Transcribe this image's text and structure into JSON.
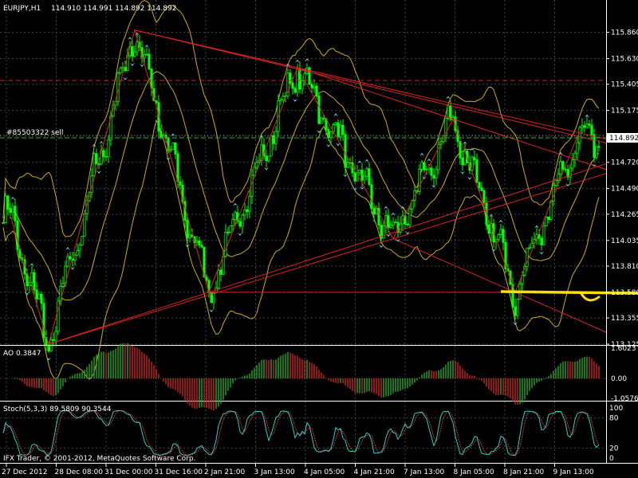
{
  "symbol_label": "EURJPY,H1",
  "ohlc_label": "114.910 114.991 114.892 114.892",
  "order_label": "#85503322 sell",
  "current_price_label": "114.892",
  "ao_label": "AO 0.3847",
  "stoch_label": "Stoch(5,3,3) 89.5809 90.3544",
  "copyright_label": "IFX Trader, © 2001-2012, MetaQuotes Software Corp.",
  "colors": {
    "background": "#000000",
    "grid": "#3a4a4a",
    "candle": "#00ff00",
    "bollinger": "#ccaa22",
    "zigzag": "#dd2222",
    "fractal": "#66ccdd",
    "order_line": "#33aa33",
    "level_line": "#cc2222",
    "highlight": "#ffdd00",
    "stoch_main": "#33cccc",
    "stoch_signal": "#cc3333",
    "ao_up": "#22aa22",
    "ao_down": "#cc2222"
  },
  "chart_data": [
    {
      "type": "candlestick",
      "symbol": "EURJPY",
      "timeframe": "H1",
      "y_ticks": [
        "115.860",
        "115.630",
        "115.405",
        "115.175",
        "114.950",
        "114.720",
        "114.490",
        "114.265",
        "114.035",
        "113.810",
        "113.580",
        "113.355",
        "113.125"
      ],
      "ylim": [
        113.125,
        115.99
      ],
      "x_ticks": [
        "27 Dec 2012",
        "28 Dec 08:00",
        "31 Dec 00:00",
        "31 Dec 16:00",
        "2 Jan 21:00",
        "3 Jan 13:00",
        "4 Jan 05:00",
        "4 Jan 21:00",
        "7 Jan 13:00",
        "8 Jan 05:00",
        "8 Jan 21:00",
        "9 Jan 13:00"
      ],
      "zigzag_points": [
        {
          "bar": 3,
          "price": 114.25
        },
        {
          "bar": 19,
          "price": 113.125
        },
        {
          "bar": 55,
          "price": 115.88
        },
        {
          "bar": 86,
          "price": 113.58
        },
        {
          "bar": 123,
          "price": 115.55
        },
        {
          "bar": 163,
          "price": 114.05
        },
        {
          "bar": 188,
          "price": 115.1
        },
        {
          "bar": 214,
          "price": 113.58
        },
        {
          "bar": 240,
          "price": 114.95
        }
      ]
    },
    {
      "type": "bar",
      "name": "AO",
      "y_ticks": [
        "1.6023",
        "0.00",
        "-1.0576"
      ],
      "ylim": [
        -1.0576,
        1.6023
      ]
    },
    {
      "type": "line",
      "name": "Stoch(5,3,3)",
      "y_ticks": [
        "100",
        "80",
        "20",
        "0"
      ],
      "ylim": [
        0,
        100
      ]
    }
  ]
}
